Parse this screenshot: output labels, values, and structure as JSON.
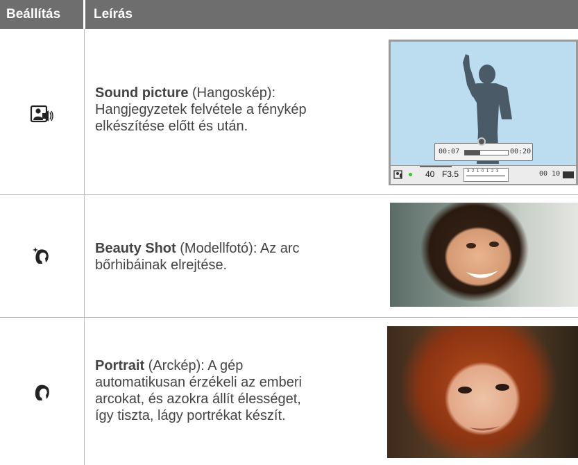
{
  "header": {
    "col1": "Beállítás",
    "col2": "Leírás"
  },
  "rows": [
    {
      "icon": "sound-picture-icon",
      "title": "Sound picture",
      "rest_line1": " (Hangoskép):",
      "line2": "Hangjegyzetek felvétele a fénykép",
      "line3": "elkészítése előtt és után."
    },
    {
      "icon": "beauty-shot-icon",
      "title": "Beauty Shot",
      "rest_line1": " (Modellfotó): Az arc",
      "line2": "bőrhibáinak elrejtése."
    },
    {
      "icon": "portrait-icon",
      "title": "Portrait",
      "rest_line1": " (Arckép): A gép",
      "line2": "automatikusan érzékeli az emberi",
      "line3": "arcokat, és azokra állít élességet,",
      "line4": "így tiszta, lágy portrékat készít."
    }
  ],
  "screen": {
    "time_start": "00:07",
    "time_end": "00:20",
    "progress": 0.35,
    "iso": "40",
    "aperture": "F3.5",
    "scale": "3 2 1 0 1 2 3",
    "counter": "00 10"
  }
}
